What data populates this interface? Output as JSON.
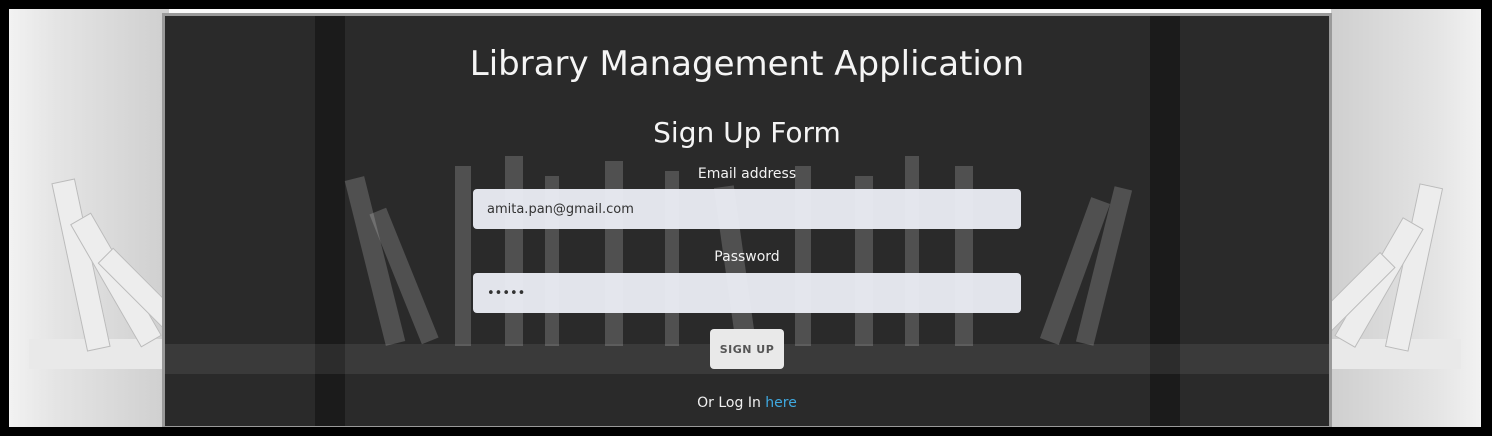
{
  "app": {
    "title": "Library Management Application"
  },
  "form": {
    "title": "Sign Up Form",
    "email_label": "Email address",
    "email_value": "amita.pan@gmail.com",
    "password_label": "Password",
    "password_value": "•••••",
    "submit_label": "SIGN UP",
    "login_prefix": "Or Log In",
    "login_link": "here"
  },
  "colors": {
    "panel": "#2a2a2a",
    "link": "#3fa9e0",
    "input_bg": "#f0f2fa"
  }
}
